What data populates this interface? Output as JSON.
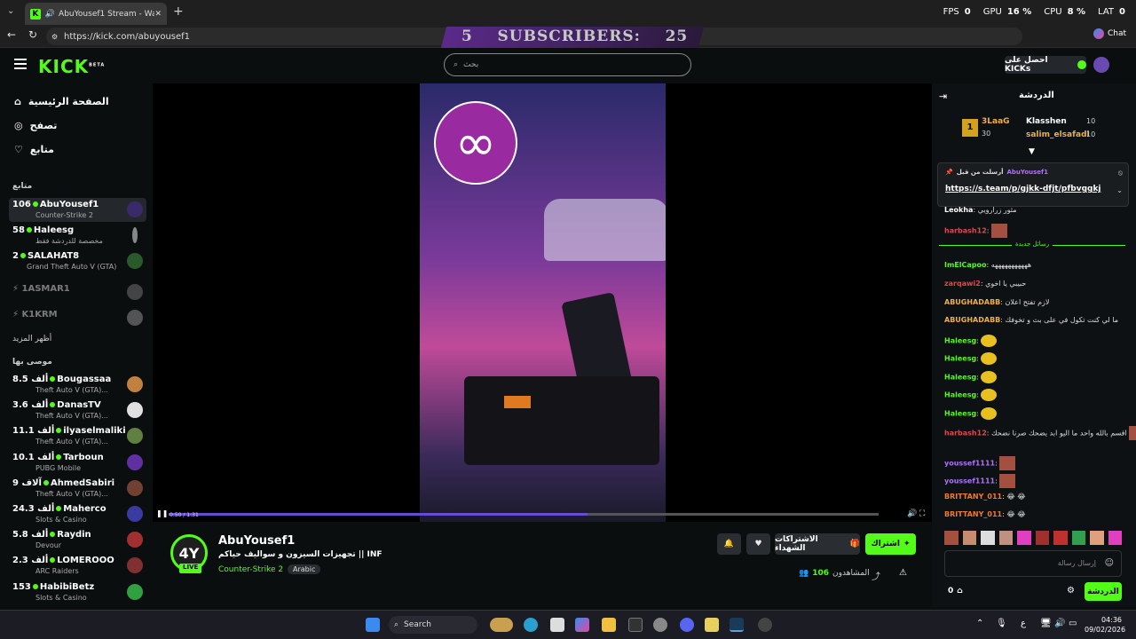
{
  "browser": {
    "tab_title": "AbuYousef1 Stream - Watch l",
    "url": "https://kick.com/abuyousef1",
    "chat_label": "Chat",
    "fps_label": "FPS",
    "fps_value": "0",
    "gpu_label": "GPU",
    "gpu_value": "16 %",
    "cpu_label": "CPU",
    "cpu_value": "8 %",
    "lat_label": "LAT",
    "lat_value": "0",
    "overlay_subs_label": "SUBSCRIBERS:",
    "overlay_subs_left": "5",
    "overlay_subs_count": "25"
  },
  "header": {
    "logo": "KICK",
    "logo_badge": "BETA",
    "search_placeholder": "بحث",
    "get_kicks_label": "احصل على KICKs"
  },
  "sidebar": {
    "nav": [
      {
        "label": "الصفحة الرئيسية",
        "icon": "home-icon"
      },
      {
        "label": "تصفح",
        "icon": "compass-icon"
      },
      {
        "label": "متابع",
        "icon": "heart-icon"
      }
    ],
    "following_title": "متابع",
    "following": [
      {
        "viewers": "106",
        "name": "AbuYousef1",
        "game": "Counter-Strike 2",
        "live": true
      },
      {
        "viewers": "58",
        "name": "Haleesg",
        "game": "مخصصة للدردشة فقط",
        "live": true
      },
      {
        "viewers": "2",
        "name": "SALAHAT8",
        "game": "Grand Theft Auto V (GTA)",
        "live": true
      },
      {
        "viewers": "",
        "name": "1ASMAR1",
        "game": "",
        "live": false
      },
      {
        "viewers": "",
        "name": "K1KRM",
        "game": "",
        "live": false
      }
    ],
    "show_more": "أظهر المزيد",
    "recommended_title": "موصى بها",
    "recommended": [
      {
        "viewers": "8.5 ألف",
        "name": "Bougassaa",
        "game": "Theft Auto V (GTA)..."
      },
      {
        "viewers": "3.6 ألف",
        "name": "DanasTV",
        "game": "Theft Auto V (GTA)..."
      },
      {
        "viewers": "11.1 ألف",
        "name": "ilyaselmaliki",
        "game": "Theft Auto V (GTA)..."
      },
      {
        "viewers": "10.1 ألف",
        "name": "Tarboun",
        "game": "PUBG Mobile"
      },
      {
        "viewers": "9 آلاف",
        "name": "AhmedSabiri",
        "game": "Theft Auto V (GTA)..."
      },
      {
        "viewers": "24.3 ألف",
        "name": "Maherco",
        "game": "Slots & Casino"
      },
      {
        "viewers": "5.8 ألف",
        "name": "Raydin",
        "game": "Devour"
      },
      {
        "viewers": "2.3 ألف",
        "name": "LOMEROOO",
        "game": "ARC Raiders"
      },
      {
        "viewers": "153",
        "name": "HabibiBetz",
        "game": "Slots & Casino"
      }
    ]
  },
  "player": {
    "time": "0:50 / 1:31",
    "progress_fraction": 0.59
  },
  "stream": {
    "channel": "AbuYousef1",
    "title": "تجهيزات السيزون و سواليف حياكم || INF",
    "category": "Counter-Strike 2",
    "tag": "Arabic",
    "live_label": "LIVE",
    "viewers_label": "المشاهدون",
    "viewers": "106",
    "subscribe_label": "اشتراك",
    "gift_label": "الاشتراكات الشهداء"
  },
  "chat": {
    "title": "الدردشة",
    "leaderboard": [
      {
        "rank": "1",
        "name": "3LaaG",
        "count": "30"
      },
      {
        "name": "Klasshen",
        "count": "10"
      },
      {
        "name": "salim_elsafadi",
        "count": "10"
      }
    ],
    "pinned_by_label": "أرسلت من قبل",
    "pinned_user": "AbuYousef1",
    "pinned_link": "https://s.team/p/gjkk-dfjt/pfbvggkj",
    "new_messages_label": "رسائل جديدة",
    "messages": [
      {
        "user": "Leokha",
        "text": "مثور زرارويي",
        "color": "#ffffff"
      },
      {
        "user": "harbash12",
        "text": "",
        "color": "#e0484a",
        "emote": "face"
      },
      {
        "user": "ImElCapoo",
        "text": "هههههههههههه",
        "color": "#53fc18"
      },
      {
        "user": "zarqawi2",
        "text": "حبيبي يا اخوي",
        "color": "#e0484a"
      },
      {
        "user": "ABUGHADABB",
        "text": "لازم تفتح اعلان",
        "color": "#f0b040"
      },
      {
        "user": "ABUGHADABB",
        "text": "ما لي كنت تكول في على بث و تخوفك",
        "color": "#f0b040"
      },
      {
        "user": "Haleesg",
        "text": "",
        "color": "#53fc18",
        "emote": "lemon"
      },
      {
        "user": "Haleesg",
        "text": "",
        "color": "#53fc18",
        "emote": "lemon"
      },
      {
        "user": "Haleesg",
        "text": "",
        "color": "#53fc18",
        "emote": "lemon"
      },
      {
        "user": "Haleesg",
        "text": "",
        "color": "#53fc18",
        "emote": "lemon"
      },
      {
        "user": "Haleesg",
        "text": "",
        "color": "#53fc18",
        "emote": "lemon"
      },
      {
        "user": "harbash12",
        "text": "اقسم بالله واحد ما اليو ابد يضحك صرنا نضحك",
        "color": "#e0484a",
        "emote": "face"
      },
      {
        "user": "youssef1111",
        "text": "",
        "color": "#b070ff",
        "emote": "face"
      },
      {
        "user": "youssef1111",
        "text": "",
        "color": "#b070ff",
        "emote": "face"
      },
      {
        "user": "BRITTANY_011",
        "text": "😂 😂",
        "color": "#f07830"
      },
      {
        "user": "BRITTANY_011",
        "text": "😂 😂",
        "color": "#f07830"
      }
    ],
    "input_placeholder": "إرسال رسالة",
    "send_label": "الدردشة",
    "kicks_count": "0"
  },
  "taskbar": {
    "search_label": "Search",
    "time": "04:36",
    "date": "09/02/2026",
    "lang": "ع"
  }
}
